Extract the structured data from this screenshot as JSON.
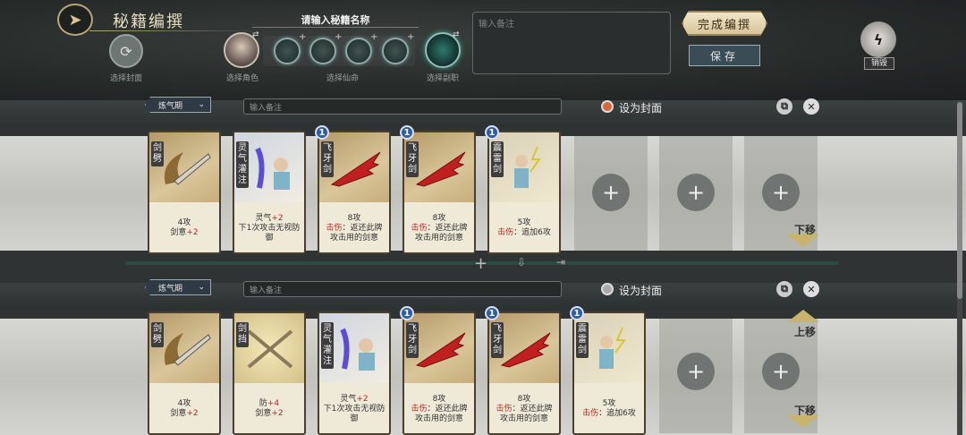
{
  "header": {
    "title": "秘籍编撰",
    "cover_caption": "选择封面",
    "role_caption": "选择角色",
    "name_prompt": "请输入秘籍名称",
    "destiny_caption": "选择仙命",
    "main_caption": "选择副职",
    "notes_placeholder": "输入备注",
    "finish_label": "完成编撰",
    "save_label": "保存",
    "destroy_label": "销毁"
  },
  "rows": [
    {
      "stage": "炼气期",
      "note_placeholder": "输入备注",
      "set_cover": "设为封面",
      "move_down": "下移",
      "cards": [
        {
          "name": "剑劈",
          "line1": "4攻",
          "line2": "剑意+2",
          "badge": ""
        },
        {
          "name": "灵气灌注",
          "line1": "灵气+2",
          "line2": "下1次攻击无视防御",
          "badge": ""
        },
        {
          "name": "飞牙剑",
          "line1": "8攻",
          "line2": "击伤：返还此牌攻击用的剑意",
          "badge": "1"
        },
        {
          "name": "飞牙剑",
          "line1": "8攻",
          "line2": "击伤：返还此牌攻击用的剑意",
          "badge": "1"
        },
        {
          "name": "震雷剑",
          "line1": "5攻",
          "line2": "击伤：追加6攻",
          "badge": "1"
        }
      ]
    },
    {
      "stage": "炼气期",
      "note_placeholder": "输入备注",
      "set_cover": "设为封面",
      "move_up": "上移",
      "move_down": "下移",
      "cards": [
        {
          "name": "剑劈",
          "line1": "4攻",
          "line2": "剑意+2",
          "badge": ""
        },
        {
          "name": "剑挡",
          "line1": "防+4",
          "line2": "剑意+2",
          "badge": ""
        },
        {
          "name": "灵气灌注",
          "line1": "灵气+2",
          "line2": "下1次攻击无视防御",
          "badge": ""
        },
        {
          "name": "飞牙剑",
          "line1": "8攻",
          "line2": "击伤：返还此牌攻击用的剑意",
          "badge": "1"
        },
        {
          "name": "飞牙剑",
          "line1": "8攻",
          "line2": "击伤：返还此牌攻击用的剑意",
          "badge": "1"
        },
        {
          "name": "震雷剑",
          "line1": "5攻",
          "line2": "击伤：追加6攻",
          "badge": "1"
        }
      ]
    }
  ],
  "icons": {
    "back": "arrow-back-icon",
    "swap": "swap-icon",
    "plus": "plus-icon",
    "copy": "copy-icon",
    "close": "close-icon"
  }
}
